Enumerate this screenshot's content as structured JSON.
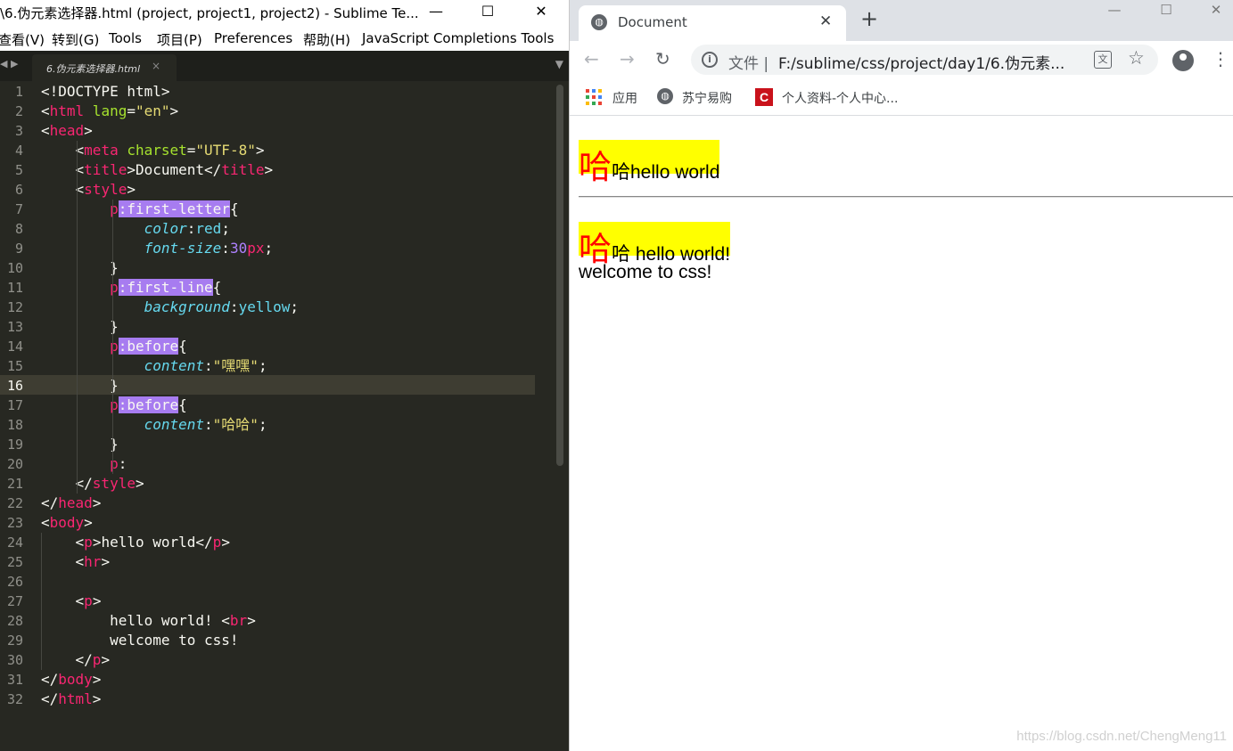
{
  "sublime": {
    "title": "\\6.伪元素选择器.html (project, project1, project2) - Sublime Te...",
    "menu": [
      "查看(V)",
      "转到(G)",
      "Tools",
      "项目(P)",
      "Preferences",
      "帮助(H)",
      "JavaScript Completions Tools"
    ],
    "tab": {
      "label": "6.伪元素选择器.html",
      "close": "×"
    },
    "nav_arrows": "◀ ▶",
    "tab_dropdown": "▼",
    "window_controls": {
      "minimize": "—",
      "maximize": "☐",
      "close": "✕"
    },
    "active_line": 16,
    "line_numbers": [
      "1",
      "2",
      "3",
      "4",
      "5",
      "6",
      "7",
      "8",
      "9",
      "10",
      "11",
      "12",
      "13",
      "14",
      "15",
      "16",
      "17",
      "18",
      "19",
      "20",
      "21",
      "22",
      "23",
      "24",
      "25",
      "26",
      "27",
      "28",
      "29",
      "30",
      "31",
      "32"
    ],
    "code_lines": [
      [
        [
          "",
          "<!DOCTYPE html>"
        ]
      ],
      [
        [
          "",
          "<"
        ],
        [
          "tag",
          "html"
        ],
        [
          "attr",
          " lang"
        ],
        [
          "",
          "="
        ],
        [
          "str",
          "\"en\""
        ],
        [
          "",
          ">"
        ]
      ],
      [
        [
          "",
          "<"
        ],
        [
          "tag",
          "head"
        ],
        [
          "",
          ">"
        ]
      ],
      [
        [
          "",
          "    <"
        ],
        [
          "tag",
          "meta"
        ],
        [
          "attr",
          " charset"
        ],
        [
          "",
          "="
        ],
        [
          "str",
          "\"UTF-8\""
        ],
        [
          "",
          ">"
        ]
      ],
      [
        [
          "",
          "    <"
        ],
        [
          "tag",
          "title"
        ],
        [
          "",
          ">Document</"
        ],
        [
          "tag",
          "title"
        ],
        [
          "",
          ">"
        ]
      ],
      [
        [
          "",
          "    <"
        ],
        [
          "tag",
          "style"
        ],
        [
          "",
          ">"
        ]
      ],
      [
        [
          "",
          "        "
        ],
        [
          "p",
          "p"
        ],
        [
          "sel",
          ":first-letter"
        ],
        [
          "",
          "{"
        ]
      ],
      [
        [
          "",
          "            "
        ],
        [
          "prop",
          "color"
        ],
        [
          "",
          ":"
        ],
        [
          "val",
          "red"
        ],
        [
          "",
          ";"
        ]
      ],
      [
        [
          "",
          "            "
        ],
        [
          "prop",
          "font-size"
        ],
        [
          "",
          ":"
        ],
        [
          "num",
          "30"
        ],
        [
          "tag",
          "px"
        ],
        [
          "",
          ";"
        ]
      ],
      [
        [
          "",
          "        }"
        ]
      ],
      [
        [
          "",
          "        "
        ],
        [
          "p",
          "p"
        ],
        [
          "sel",
          ":first-line"
        ],
        [
          "",
          "{"
        ]
      ],
      [
        [
          "",
          "            "
        ],
        [
          "prop",
          "background"
        ],
        [
          "",
          ":"
        ],
        [
          "val",
          "yellow"
        ],
        [
          "",
          ";"
        ]
      ],
      [
        [
          "",
          "        }"
        ]
      ],
      [
        [
          "",
          "        "
        ],
        [
          "p",
          "p"
        ],
        [
          "sel",
          ":before"
        ],
        [
          "",
          "{"
        ]
      ],
      [
        [
          "",
          "            "
        ],
        [
          "prop",
          "content"
        ],
        [
          "",
          ":"
        ],
        [
          "str",
          "\"嘿嘿\""
        ],
        [
          "",
          ";"
        ]
      ],
      [
        [
          "",
          "        }"
        ]
      ],
      [
        [
          "",
          "        "
        ],
        [
          "p",
          "p"
        ],
        [
          "sel",
          ":before"
        ],
        [
          "",
          "{"
        ]
      ],
      [
        [
          "",
          "            "
        ],
        [
          "prop",
          "content"
        ],
        [
          "",
          ":"
        ],
        [
          "str",
          "\"哈哈\""
        ],
        [
          "",
          ";"
        ]
      ],
      [
        [
          "",
          "        }"
        ]
      ],
      [
        [
          "",
          "        "
        ],
        [
          "p",
          "p"
        ],
        [
          "",
          ":"
        ]
      ],
      [
        [
          "",
          "    </"
        ],
        [
          "tag",
          "style"
        ],
        [
          "",
          ">"
        ]
      ],
      [
        [
          "",
          "</"
        ],
        [
          "tag",
          "head"
        ],
        [
          "",
          ">"
        ]
      ],
      [
        [
          "",
          "<"
        ],
        [
          "tag",
          "body"
        ],
        [
          "",
          ">"
        ]
      ],
      [
        [
          "",
          "    <"
        ],
        [
          "tag",
          "p"
        ],
        [
          "",
          ">hello world</"
        ],
        [
          "tag",
          "p"
        ],
        [
          "",
          ">"
        ]
      ],
      [
        [
          "",
          "    <"
        ],
        [
          "tag",
          "hr"
        ],
        [
          "",
          ">"
        ]
      ],
      [
        [
          "",
          ""
        ]
      ],
      [
        [
          "",
          "    <"
        ],
        [
          "tag",
          "p"
        ],
        [
          "",
          ">"
        ]
      ],
      [
        [
          "",
          "        hello world! <"
        ],
        [
          "tag",
          "br"
        ],
        [
          "",
          ">"
        ]
      ],
      [
        [
          "",
          "        welcome to css!"
        ]
      ],
      [
        [
          "",
          "    </"
        ],
        [
          "tag",
          "p"
        ],
        [
          "",
          ">"
        ]
      ],
      [
        [
          "",
          "</"
        ],
        [
          "tag",
          "body"
        ],
        [
          "",
          ">"
        ]
      ],
      [
        [
          "",
          "</"
        ],
        [
          "tag",
          "html"
        ],
        [
          "",
          ">"
        ]
      ]
    ]
  },
  "chrome": {
    "tab_title": "Document",
    "tab_close": "✕",
    "new_tab": "+",
    "window_controls": {
      "minimize": "—",
      "maximize": "☐",
      "close": "✕"
    },
    "back": "←",
    "forward": "→",
    "reload": "↻",
    "scheme_label": "文件 |",
    "url": "F:/sublime/css/project/day1/6.伪元素...",
    "star": "☆",
    "menu_dots": "⋮",
    "bookmarks": [
      {
        "label": "应用",
        "icon": "apps-grid-icon"
      },
      {
        "label": "苏宁易购",
        "icon": "globe-icon"
      },
      {
        "label": "个人资料-个人中心...",
        "icon": "csdn-logo-icon"
      }
    ]
  },
  "page": {
    "p1": {
      "first_letter": "哈",
      "rest": "哈hello world"
    },
    "p2": {
      "first_letter": "哈",
      "rest_line1": "哈 hello world!",
      "line2": "welcome to css!"
    }
  },
  "watermark": "https://blog.csdn.net/ChengMeng11",
  "colors": {
    "editor_bg": "#272822",
    "tag": "#f92672",
    "attr": "#a6e22e",
    "string": "#e6db74",
    "property": "#66d9ef",
    "number": "#ae81ff",
    "selection": "#a77cf0",
    "first_letter": "#ff0000",
    "first_line_bg": "#ffff00"
  }
}
